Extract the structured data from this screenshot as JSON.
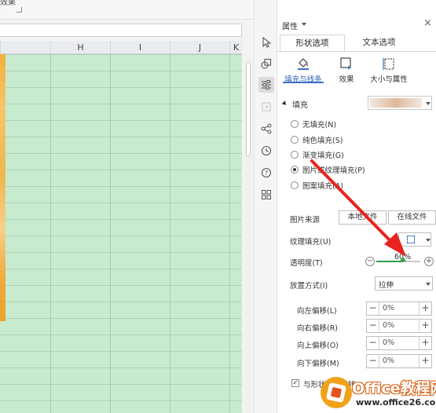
{
  "ribbon": {
    "partial_text": "效果"
  },
  "sheet": {
    "columns": [
      "H",
      "I",
      "J",
      "K"
    ]
  },
  "side_toolbar": {
    "icons": [
      "cursor-icon",
      "shape-icon",
      "property-icon",
      "transfer-icon",
      "share-icon",
      "history-icon",
      "help-icon",
      "grid-apps-icon"
    ]
  },
  "panel": {
    "title": "属性",
    "tabs": {
      "shape": "形状选项",
      "text": "文本选项"
    },
    "subtabs": {
      "fill_line": "填充与线条",
      "effects": "效果",
      "size_props": "大小与属性"
    },
    "fill_section": "填充",
    "fill_options": [
      {
        "label": "无填充(N)",
        "checked": false
      },
      {
        "label": "纯色填充(S)",
        "checked": false
      },
      {
        "label": "渐变填充(G)",
        "checked": false
      },
      {
        "label": "图片或纹理填充(P)",
        "checked": true
      },
      {
        "label": "图案填充(A)",
        "checked": false
      }
    ],
    "image_source_label": "图片来源",
    "local_file_btn": "本地文件",
    "online_file_btn": "在线文件",
    "texture_fill_label": "纹理填充(U)",
    "transparency_label": "透明度(T)",
    "transparency_value": "60%",
    "transparency_percent": 60,
    "placement_label": "放置方式(I)",
    "placement_value": "拉伸",
    "offsets": [
      {
        "label": "向左偏移(L)",
        "value": "0%"
      },
      {
        "label": "向右偏移(R)",
        "value": "0%"
      },
      {
        "label": "向上偏移(O)",
        "value": "0%"
      },
      {
        "label": "向下偏移(M)",
        "value": "0%"
      }
    ],
    "rotate_with_shape_label": "与形状一起旋转"
  },
  "watermark": {
    "title": "Office教程网",
    "url": "www.office26.com"
  },
  "colors": {
    "accent": "#3a6fc4",
    "grid_bg": "#c8ebcf",
    "arrow": "#e8231f",
    "slider": "#2e9c4a"
  }
}
